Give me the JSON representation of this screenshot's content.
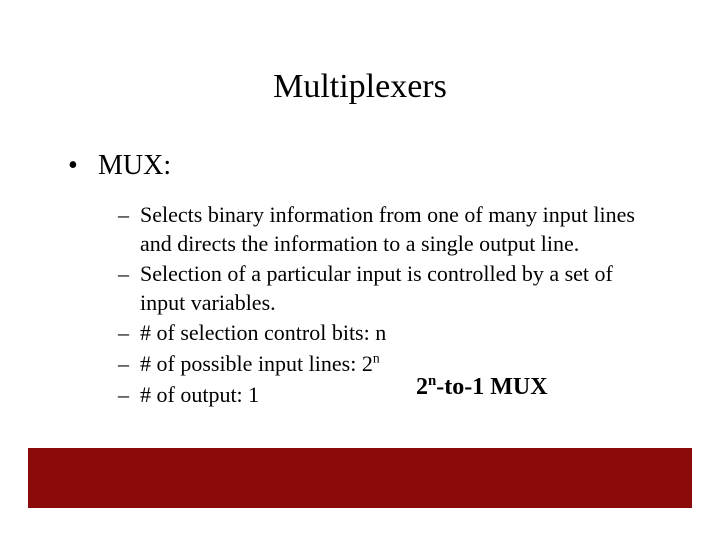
{
  "title": "Multiplexers",
  "bullet_main": {
    "marker": "•",
    "label": "MUX:"
  },
  "sub_marker": "–",
  "sub_items": [
    "Selects binary information from one of many input lines and directs the information to a single output line.",
    "Selection of a particular input is controlled by a set of input variables.",
    "# of selection control bits: n",
    "# of possible input lines: 2",
    "# of output: 1"
  ],
  "input_lines_exponent": "n",
  "mux_label": {
    "prefix": "2",
    "exp": "n",
    "suffix": "-to-1 MUX"
  },
  "colors": {
    "footer": "#8b0b0b"
  }
}
